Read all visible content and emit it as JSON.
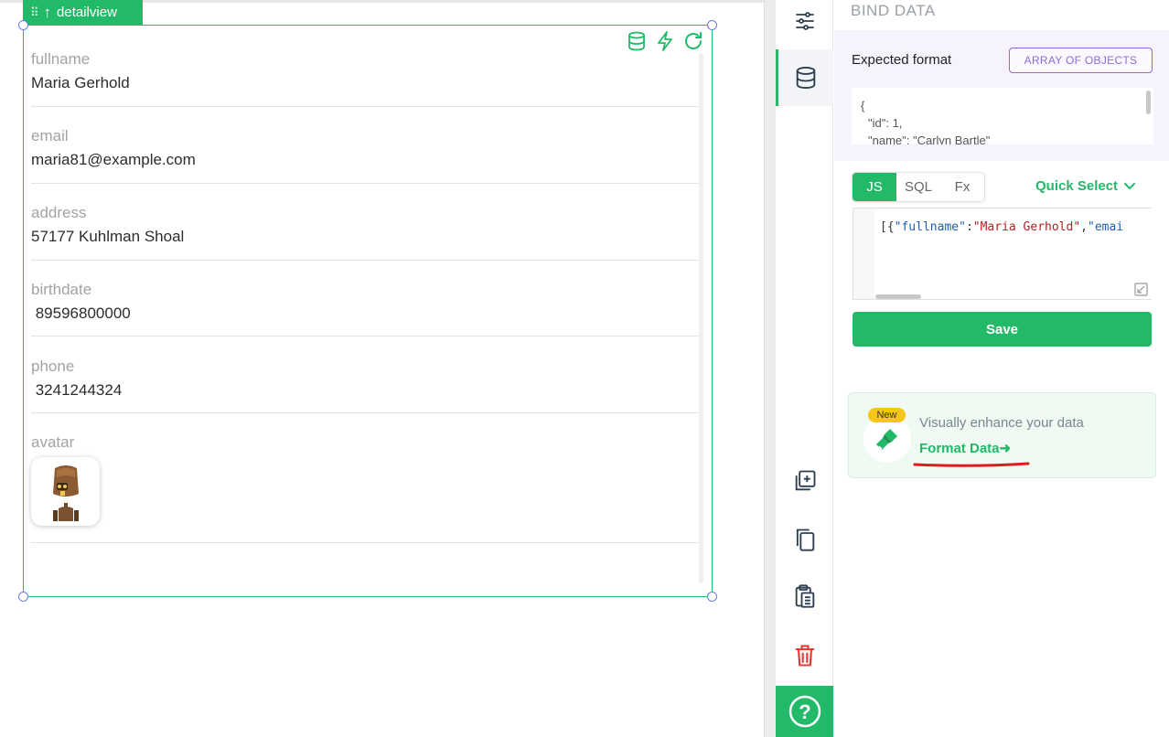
{
  "widget": {
    "tag_label": "detailview",
    "fields": [
      {
        "label": "fullname",
        "value": "Maria Gerhold"
      },
      {
        "label": "email",
        "value": "maria81@example.com"
      },
      {
        "label": "address",
        "value": "57177 Kuhlman Shoal"
      },
      {
        "label": "birthdate",
        "value": " 89596800000"
      },
      {
        "label": "phone",
        "value": " 3241244324"
      }
    ],
    "avatar_label": "avatar",
    "icons": [
      "database-icon",
      "lightning-icon",
      "refresh-icon"
    ]
  },
  "side_strip": {
    "icons": [
      "settings-sliders-icon",
      "database-icon",
      "add-copy-icon",
      "copy-icon",
      "clipboard-icon",
      "trash-icon",
      "help-icon"
    ],
    "help_symbol": "?"
  },
  "panel": {
    "title": "BIND DATA",
    "expected_format_label": "Expected format",
    "expected_format_badge": "ARRAY OF OBJECTS",
    "expected_code": {
      "line1": "{",
      "line2": "\"id\": 1,",
      "line3": "\"name\": \"Carlyn Bartle\""
    },
    "tabs": [
      {
        "label": "JS",
        "active": true
      },
      {
        "label": "SQL",
        "active": false
      },
      {
        "label": "Fx",
        "active": false
      }
    ],
    "quick_select": "Quick Select",
    "editor": {
      "t1": "[{",
      "t2": "\"fullname\"",
      "t3": ":",
      "t4": "\"Maria Gerhold\"",
      "t5": ",",
      "t6": "\"emai"
    },
    "save_label": "Save",
    "promo": {
      "badge": "New",
      "text": "Visually enhance your data",
      "link": "Format Data",
      "link_arrow": "➜"
    }
  },
  "colors": {
    "accent": "#22b969",
    "purple": "#8d6bd8",
    "danger": "#e53935",
    "highlight_underline": "#e01b1b"
  }
}
